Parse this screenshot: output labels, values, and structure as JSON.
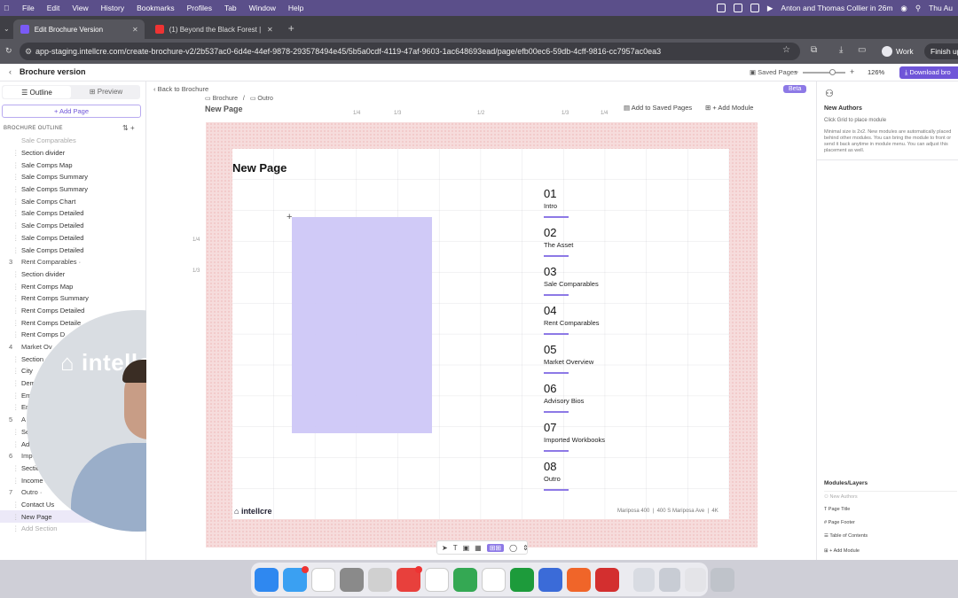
{
  "menubar": {
    "items": [
      "File",
      "Edit",
      "View",
      "History",
      "Bookmarks",
      "Profiles",
      "Tab",
      "Window",
      "Help"
    ],
    "meeting": "Anton and Thomas Collier in 26m",
    "clock": "Thu Au"
  },
  "browser": {
    "tabs": [
      {
        "title": "Edit Brochure Version",
        "active": true,
        "fav": "#7a5af5"
      },
      {
        "title": "(1) Beyond the Black Forest |",
        "active": false,
        "fav": "#e33"
      }
    ],
    "url": "app-staging.intellcre.com/create-brochure-v2/2b537ac0-6d4e-44ef-9878-293578494e45/5b5a0cdf-4119-47af-9603-1ac648693ead/page/efb00ec6-59db-4cff-9816-cc7957ac0ea3",
    "profile": "Work",
    "finish": "Finish up"
  },
  "appbar": {
    "title": "Brochure version",
    "saved_pages": "Saved Pages",
    "zoom": "126%",
    "download": "Download bro"
  },
  "sidebar": {
    "tab_outline": "Outline",
    "tab_preview": "Preview",
    "add_page": "+ Add Page",
    "header": "BROCHURE OUTLINE",
    "items": [
      {
        "t": "Sale Comparables",
        "sec": true,
        "n": "",
        "muted": true
      },
      {
        "t": "Section divider"
      },
      {
        "t": "Sale Comps Map"
      },
      {
        "t": "Sale Comps Summary"
      },
      {
        "t": "Sale Comps Summary"
      },
      {
        "t": "Sale Comps Chart"
      },
      {
        "t": "Sale Comps Detailed"
      },
      {
        "t": "Sale Comps Detailed"
      },
      {
        "t": "Sale Comps Detailed"
      },
      {
        "t": "Sale Comps Detailed"
      },
      {
        "t": "Rent Comparables ·",
        "sec": true,
        "n": "3"
      },
      {
        "t": "Section divider"
      },
      {
        "t": "Rent Comps Map"
      },
      {
        "t": "Rent Comps Summary"
      },
      {
        "t": "Rent Comps Detailed"
      },
      {
        "t": "Rent Comps Detaile"
      },
      {
        "t": "Rent Comps D"
      },
      {
        "t": "Market Ov",
        "sec": true,
        "n": "4"
      },
      {
        "t": "Section"
      },
      {
        "t": "City"
      },
      {
        "t": "Dem"
      },
      {
        "t": "Em"
      },
      {
        "t": "Em"
      },
      {
        "t": "A",
        "sec": true,
        "n": "5"
      },
      {
        "t": "Se"
      },
      {
        "t": "Adv"
      },
      {
        "t": "Import",
        "sec": true,
        "n": "6"
      },
      {
        "t": "Section d"
      },
      {
        "t": "Income & Exp"
      },
      {
        "t": "Outro ·",
        "sec": true,
        "n": "7"
      },
      {
        "t": "Contact Us"
      },
      {
        "t": "New Page",
        "sel": true
      },
      {
        "t": "Add Section",
        "muted": true
      }
    ]
  },
  "webcam": {
    "logo": "intellcre"
  },
  "editor": {
    "back": "Back to Brochure",
    "crumb1": "Brochure",
    "crumb_sep": "/",
    "crumb2": "Outro",
    "page_title": "New Page",
    "add_saved": "Add to Saved Pages",
    "add_module": "+ Add Module",
    "beta": "Beta",
    "rulers": {
      "r1": "1/4",
      "r2": "1/3",
      "r3": "1/2",
      "r4": "1/3",
      "r5": "1/4",
      "v1": "1/4",
      "v2": "1/3"
    },
    "page": {
      "heading": "New Page",
      "footer_logo": "intellcre",
      "footer_a": "Mariposa 400",
      "footer_b": "400 S Mariposa Ave",
      "footer_c": "4K",
      "toc": [
        {
          "n": "01",
          "l": "Intro"
        },
        {
          "n": "02",
          "l": "The Asset"
        },
        {
          "n": "03",
          "l": "Sale Comparables"
        },
        {
          "n": "04",
          "l": "Rent Comparables"
        },
        {
          "n": "05",
          "l": "Market Overview"
        },
        {
          "n": "06",
          "l": "Advisory Bios"
        },
        {
          "n": "07",
          "l": "Imported Workbooks"
        },
        {
          "n": "08",
          "l": "Outro"
        }
      ]
    }
  },
  "rpanel": {
    "title": "New Authors",
    "subtitle": "Click Grid to place module",
    "desc": "Minimal size is 2x2. New modules are automatically placed behind other modules. You can bring the module to front or send it back anytime in module menu. You can adjust this placement as well.",
    "layers_title": "Modules/Layers",
    "layers": [
      "New Authors",
      "Page Title",
      "Page Footer",
      "Table of Contents",
      "+ Add Module"
    ]
  },
  "dock": {
    "apps": [
      {
        "c": "#2f88f0"
      },
      {
        "c": "#3aa0f2",
        "b": true
      },
      {
        "c": "#ffffff"
      },
      {
        "c": "#8a8a8a"
      },
      {
        "c": "#d0d0d0"
      },
      {
        "c": "#e8403c",
        "b": true
      },
      {
        "c": "#ffffff"
      },
      {
        "c": "#34a853"
      },
      {
        "c": "#ffffff"
      },
      {
        "c": "#1d9b3b"
      },
      {
        "c": "#3b6bd8"
      },
      {
        "c": "#f06529"
      },
      {
        "c": "#d32f2f"
      }
    ]
  }
}
